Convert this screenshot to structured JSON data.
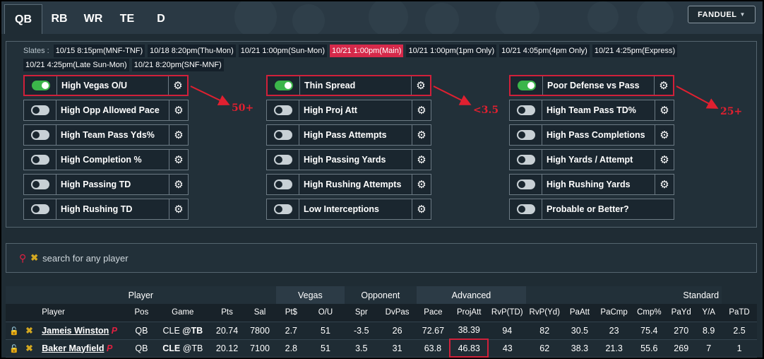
{
  "site": "FANDUEL",
  "tabs": [
    "QB",
    "RB",
    "WR",
    "TE",
    "D"
  ],
  "active_tab": "QB",
  "slates_label": "Slates :",
  "slates": [
    {
      "label": "10/15 8:15pm(MNF-TNF)",
      "active": false
    },
    {
      "label": "10/18 8:20pm(Thu-Mon)",
      "active": false
    },
    {
      "label": "10/21 1:00pm(Sun-Mon)",
      "active": false
    },
    {
      "label": "10/21 1:00pm(Main)",
      "active": true
    },
    {
      "label": "10/21 1:00pm(1pm Only)",
      "active": false
    },
    {
      "label": "10/21 4:05pm(4pm Only)",
      "active": false
    },
    {
      "label": "10/21 4:25pm(Express)",
      "active": false
    },
    {
      "label": "10/21 4:25pm(Late Sun-Mon)",
      "active": false
    },
    {
      "label": "10/21 8:20pm(SNF-MNF)",
      "active": false
    }
  ],
  "filters": {
    "col1": [
      {
        "label": "High Vegas O/U",
        "on": true,
        "gear": true,
        "highlight": true
      },
      {
        "label": "High Opp Allowed Pace",
        "on": false,
        "gear": true
      },
      {
        "label": "High Team Pass Yds%",
        "on": false,
        "gear": true
      },
      {
        "label": "High Completion %",
        "on": false,
        "gear": true
      },
      {
        "label": "High Passing TD",
        "on": false,
        "gear": true
      },
      {
        "label": "High Rushing TD",
        "on": false,
        "gear": true
      }
    ],
    "col2": [
      {
        "label": "Thin Spread",
        "on": true,
        "gear": true,
        "highlight": true
      },
      {
        "label": "High Proj Att",
        "on": false,
        "gear": true
      },
      {
        "label": "High Pass Attempts",
        "on": false,
        "gear": true
      },
      {
        "label": "High Passing Yards",
        "on": false,
        "gear": true
      },
      {
        "label": "High Rushing Attempts",
        "on": false,
        "gear": true
      },
      {
        "label": "Low Interceptions",
        "on": false,
        "gear": true
      }
    ],
    "col3": [
      {
        "label": "Poor Defense vs Pass",
        "on": true,
        "gear": true,
        "highlight": true
      },
      {
        "label": "High Team Pass TD%",
        "on": false,
        "gear": true
      },
      {
        "label": "High Pass Completions",
        "on": false,
        "gear": true
      },
      {
        "label": "High Yards / Attempt",
        "on": false,
        "gear": true
      },
      {
        "label": "High Rushing Yards",
        "on": false,
        "gear": true
      },
      {
        "label": "Probable or Better?",
        "on": false,
        "gear": false
      }
    ]
  },
  "annotations": [
    "50+",
    "<3.5",
    "25+"
  ],
  "search": {
    "placeholder": "search for any player"
  },
  "table": {
    "groups": [
      {
        "label": "Player",
        "span": 7
      },
      {
        "label": "Vegas",
        "span": 2
      },
      {
        "label": "Opponent",
        "span": 2
      },
      {
        "label": "Advanced",
        "span": 3
      },
      {
        "label": "Standard",
        "span": 6
      }
    ],
    "columns": [
      "",
      "",
      "Player",
      "Pos",
      "Game",
      "Pts",
      "Sal",
      "Pt$",
      "O/U",
      "Spr",
      "DvPas",
      "Pace",
      "ProjAtt",
      "RvP(TD)",
      "RvP(Yd)",
      "PaAtt",
      "PaCmp",
      "Cmp%",
      "PaYd",
      "Y/A",
      "PaTD"
    ],
    "rows": [
      {
        "name": "Jameis Winston",
        "flag": "P",
        "pos": "QB",
        "team": "CLE",
        "opp": "@TB",
        "team_bold": false,
        "opp_bold": true,
        "vals": [
          "20.74",
          "7800",
          "2.7",
          "51",
          "-3.5",
          "26",
          "72.67",
          "38.39",
          "94",
          "82",
          "30.5",
          "23",
          "75.4",
          "270",
          "8.9",
          "2.5"
        ]
      },
      {
        "name": "Baker Mayfield",
        "flag": "P",
        "pos": "QB",
        "team": "CLE",
        "opp": "@TB",
        "team_bold": true,
        "opp_bold": false,
        "vals": [
          "20.12",
          "7100",
          "2.8",
          "51",
          "3.5",
          "31",
          "63.8",
          "46.83",
          "43",
          "62",
          "38.3",
          "21.3",
          "55.6",
          "269",
          "7",
          "1"
        ]
      }
    ]
  },
  "colors": {
    "accent_red": "#d6294a",
    "toggle_on": "#3bb54a",
    "background": "#1f2c34"
  }
}
